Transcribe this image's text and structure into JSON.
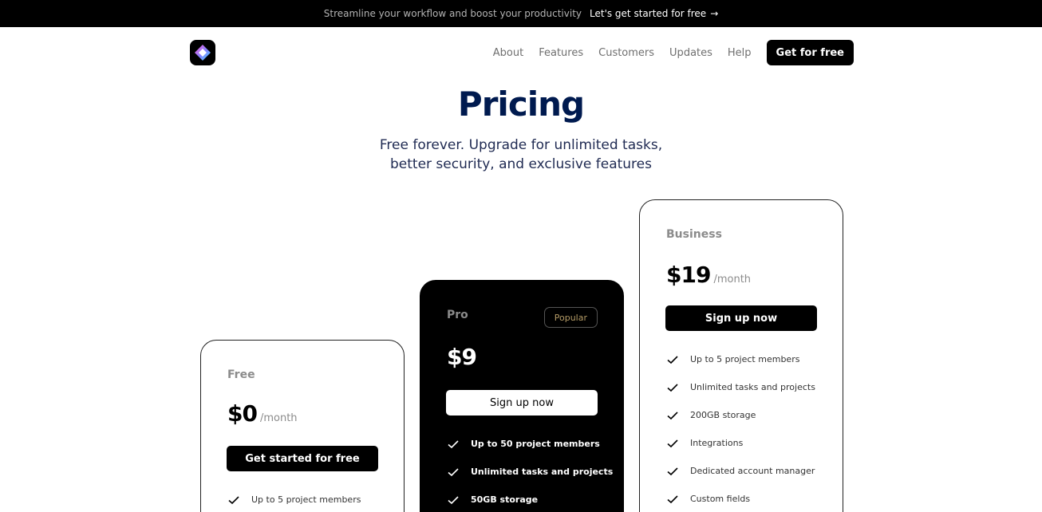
{
  "banner": {
    "text": "Streamline your workflow and boost your productivity",
    "link": "Let's get started for free",
    "link_icon": "arrow-right-icon"
  },
  "header": {
    "logo_icon": "diamond-logo-icon",
    "nav": [
      "About",
      "Features",
      "Customers",
      "Updates",
      "Help"
    ],
    "cta": "Get for free"
  },
  "hero": {
    "title": "Pricing",
    "subtitle": "Free forever. Upgrade for unlimited tasks, better security, and exclusive features"
  },
  "plans": [
    {
      "name": "Free",
      "price": "$0",
      "period": "/month",
      "cta": "Get started for free",
      "features": [
        "Up to 5 project members"
      ]
    },
    {
      "name": "Pro",
      "badge": "Popular",
      "price": "$9",
      "cta": "Sign up now",
      "features": [
        "Up to 50 project members",
        "Unlimited tasks and projects",
        "50GB storage"
      ]
    },
    {
      "name": "Business",
      "price": "$19",
      "period": "/month",
      "cta": "Sign up now",
      "features": [
        "Up to 5 project members",
        "Unlimited tasks and projects",
        "200GB storage",
        "Integrations",
        "Dedicated account manager",
        "Custom fields"
      ]
    }
  ],
  "colors": {
    "title": "#001a4f",
    "muted": "#8b8b8b",
    "badge": "#b49b66"
  }
}
